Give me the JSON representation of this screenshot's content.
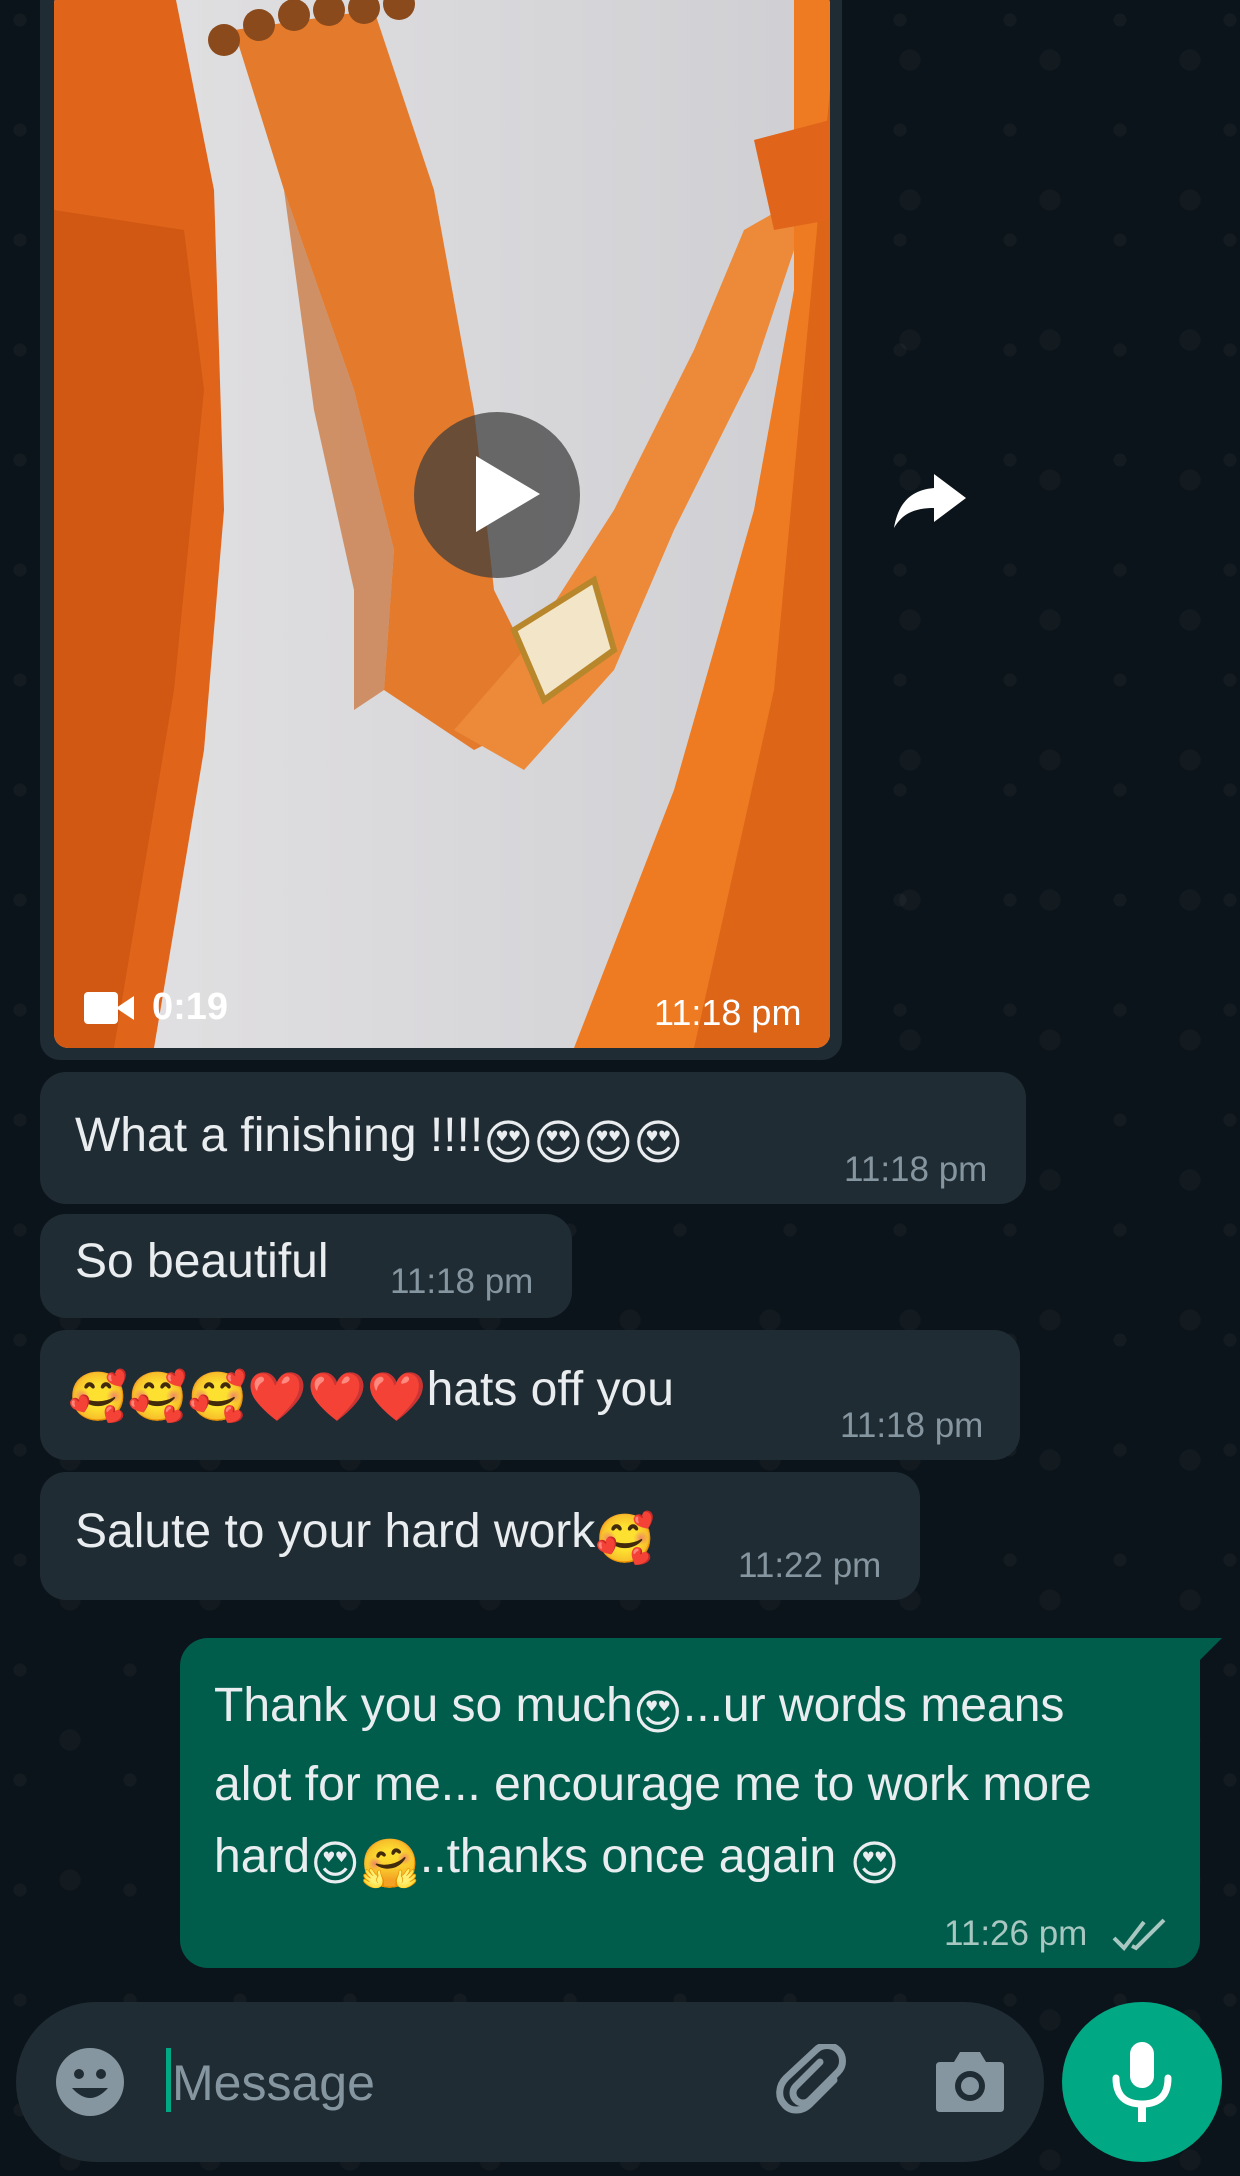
{
  "video_message": {
    "duration": "0:19",
    "time": "11:18 pm",
    "icons": [
      "video-camera-icon",
      "play-icon",
      "forward-icon"
    ]
  },
  "messages": [
    {
      "text": "What a finishing !!!!",
      "emoji": "😍😍😍😍",
      "time": "11:18 pm"
    },
    {
      "text": "So beautiful",
      "time": "11:18 pm"
    },
    {
      "emoji": "🥰🥰🥰❤️❤️❤️",
      "text": "hats off you",
      "time": "11:18 pm"
    },
    {
      "text": "Salute to your hard work",
      "emoji": "🥰",
      "time": "11:22 pm"
    }
  ],
  "outgoing": {
    "part1": "Thank you so much",
    "emoji1": "😍",
    "part2": "...ur words means alot for me... encourage me to work more hard",
    "emoji2": "😍🤗",
    "part3": "..thanks once again ",
    "emoji3": "😍",
    "time": "11:26 pm",
    "status": "read"
  },
  "composer": {
    "placeholder": "Message",
    "icons": [
      "emoji-icon",
      "attach-icon",
      "camera-icon",
      "mic-icon"
    ]
  },
  "colors": {
    "background": "#0b141a",
    "incoming_bubble": "#202c33",
    "outgoing_bubble": "#005c4b",
    "accent": "#00a884"
  }
}
